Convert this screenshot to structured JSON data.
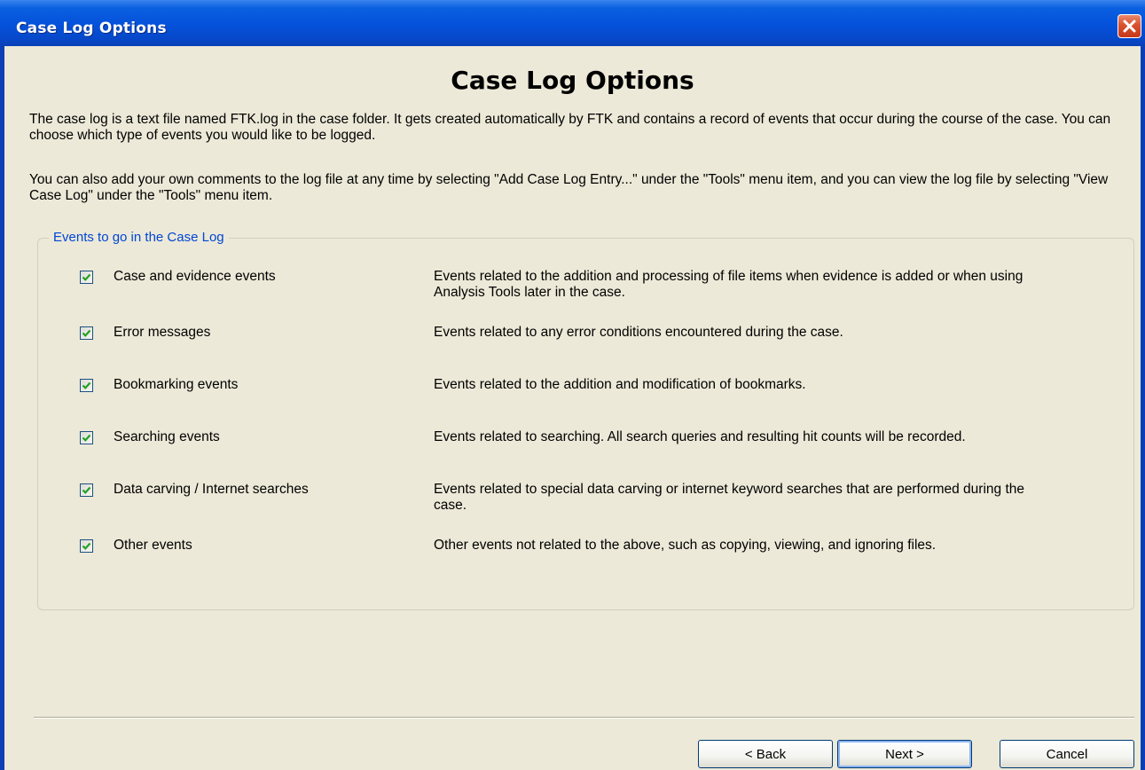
{
  "window": {
    "title": "Case Log Options"
  },
  "content": {
    "heading": "Case Log Options",
    "paragraph1": "The case log is a text file named FTK.log in the case folder. It gets created automatically by FTK and contains a record of events that occur during the course of the case. You can choose which type of events you would like to be logged.",
    "paragraph2": "You can also add your own comments to the log file at any time by selecting \"Add Case Log Entry...\" under the \"Tools\" menu item, and you can view the log file by selecting \"View Case Log\" under the \"Tools\" menu item."
  },
  "events_group": {
    "label": "Events to go in the Case Log",
    "items": [
      {
        "label": "Case and evidence events",
        "checked": true,
        "description": "Events related to the addition and processing of file items when evidence is added or when using Analysis Tools later in the case."
      },
      {
        "label": "Error messages",
        "checked": true,
        "description": "Events related to any error conditions encountered during the case."
      },
      {
        "label": "Bookmarking events",
        "checked": true,
        "description": "Events related to the addition and modification of bookmarks."
      },
      {
        "label": "Searching events",
        "checked": true,
        "description": "Events related to searching. All search queries and resulting hit counts will be recorded."
      },
      {
        "label": "Data carving / Internet searches",
        "checked": true,
        "description": "Events related to special data carving or internet keyword searches that are performed during the case."
      },
      {
        "label": "Other events",
        "checked": true,
        "description": "Other events not related to the above, such as copying, viewing, and ignoring files."
      }
    ]
  },
  "buttons": {
    "back": "< Back",
    "next": "Next >",
    "cancel": "Cancel"
  },
  "colors": {
    "titlebar": "#0451da",
    "window_bg": "#ece9d8",
    "group_label": "#0046d5",
    "checkmark": "#21a121",
    "close_button": "#d8512e"
  }
}
